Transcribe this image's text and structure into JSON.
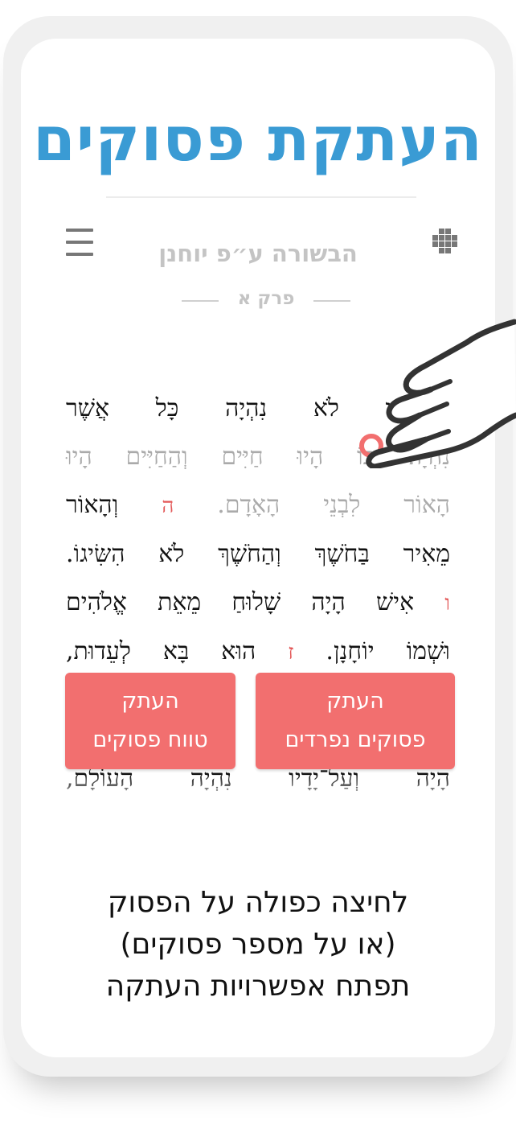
{
  "page_title": "העתקת פסוקים",
  "reader": {
    "book_title": "הבשורה ע״פ יוחנן",
    "chapter": "פרק א",
    "lines": [
      {
        "text": "עַל־יָדָיו לֹא נִהְיָה כָּל אֲשֶׁר",
        "faded": false
      },
      {
        "text": "נִהְיָה׃ בּוֹ הָיוּ חַיִּים וְהַחַיִּים הָיוּ",
        "faded": true
      },
      {
        "text": "הָאוֹר לִבְנֵי הָאָדָם.",
        "faded": true,
        "verse": "ה",
        "tail": "וְהָאוֹר"
      },
      {
        "text": "מֵאִיר בַּחֹשֶׁךְ וְהַחֹשֶׁךְ לֹא הִשִּׂיגוֹ.",
        "faded": false
      },
      {
        "verse": "ו",
        "text": "אִישׁ הָיָה שָׁלוּחַ מֵאֵת אֱלֹהִים",
        "faded": false
      },
      {
        "text": "וּשְׁמוֹ יוֹחָנָן.",
        "verse": "ז",
        "tail": "הוּא בָּא לְעֵדוּת,",
        "faded": false
      }
    ],
    "below_line": "הָיָה וְעַל־יָדָיו נִהְיָה הָעוֹלָם,"
  },
  "copy_buttons": {
    "range": {
      "line1": "העתק",
      "line2": "טווח פסוקים"
    },
    "separate": {
      "line1": "העתק",
      "line2": "פסוקים נפרדים"
    }
  },
  "instructions": {
    "line1": "לחיצה כפולה על הפסוק",
    "line2": "(או על מספר פסוקים)",
    "line3": "תפתח אפשרויות העתקה"
  },
  "colors": {
    "title": "#3a9bd4",
    "button": "#f26f6f",
    "verse_number": "#e35858"
  },
  "icons": {
    "menu": "hamburger-icon",
    "chapters": "grid-icon",
    "gesture": "pointing-hand-icon"
  }
}
